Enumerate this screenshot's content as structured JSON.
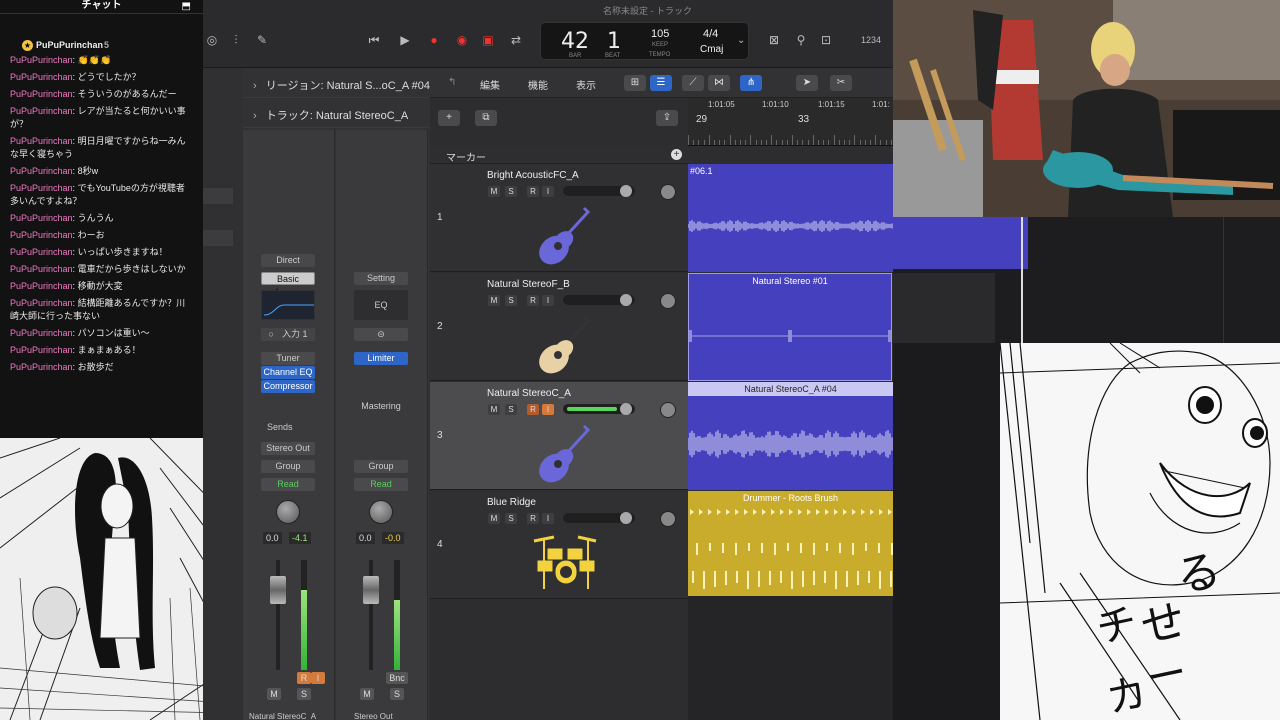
{
  "chat": {
    "title": "チャット",
    "pinned_user": "PuPuPurinchan",
    "pinned_count": "5",
    "messages": [
      {
        "user": "PuPuPurinchan",
        "text": "👏👏👏"
      },
      {
        "user": "PuPuPurinchan",
        "text": "どうでしたか？"
      },
      {
        "user": "PuPuPurinchan",
        "text": "そういうのがあるんだー"
      },
      {
        "user": "PuPuPurinchan",
        "text": "レアが当たると何かいい事が？"
      },
      {
        "user": "PuPuPurinchan",
        "text": "明日月曜ですからね一みんな早く寝ちゃう"
      },
      {
        "user": "PuPuPurinchan",
        "text": "8秒w"
      },
      {
        "user": "PuPuPurinchan",
        "text": "でもYouTubeの方が視聴者多いんですよね？"
      },
      {
        "user": "PuPuPurinchan",
        "text": "うんうん"
      },
      {
        "user": "PuPuPurinchan",
        "text": "わーお"
      },
      {
        "user": "PuPuPurinchan",
        "text": "いっぱい歩きますね！"
      },
      {
        "user": "PuPuPurinchan",
        "text": "電車だから歩きはしないか"
      },
      {
        "user": "PuPuPurinchan",
        "text": "移動が大変"
      },
      {
        "user": "PuPuPurinchan",
        "text": "結構距離あるんですか？川崎大師に行った事ない"
      },
      {
        "user": "PuPuPurinchan",
        "text": "パソコンは重い〜"
      },
      {
        "user": "PuPuPurinchan",
        "text": "まぁまぁある！"
      },
      {
        "user": "PuPuPurinchan",
        "text": "お散歩だ"
      }
    ]
  },
  "daw": {
    "window_title": "名称未設定 - トラック",
    "lcd": {
      "bar": "42",
      "beat": "1",
      "bar_label": "BAR",
      "beat_label": "BEAT",
      "tempo": "105",
      "keep": "KEEP",
      "tempo_label": "TEMPO",
      "time_sig": "4/4",
      "key": "Cmaj"
    },
    "counter": "1234",
    "inspector": {
      "region_label": "リージョン: Natural S...oC_A #04",
      "track_label": "トラック: Natural StereoC_A"
    },
    "strip1": {
      "direct": "Direct",
      "preset": "Basic Acou...",
      "input": "入力 1",
      "tuner": "Tuner",
      "eq": "Channel EQ",
      "comp": "Compressor",
      "sends": "Sends",
      "output": "Stereo Out",
      "group": "Group",
      "read": "Read",
      "pan_value": "0.0",
      "level": "-4.1",
      "r": "R",
      "i": "I",
      "m": "M",
      "s": "S",
      "name": "Natural StereoC_A"
    },
    "strip2": {
      "setting": "Setting",
      "eq": "EQ",
      "limiter": "Limiter",
      "mastering": "Mastering",
      "group": "Group",
      "read": "Read",
      "pan_value": "0.0",
      "level": "-0.0",
      "bnc": "Bnc",
      "m": "M",
      "s": "S",
      "name": "Stereo Out"
    },
    "menus": {
      "edit": "編集",
      "function": "機能",
      "view": "表示"
    },
    "marker": "マーカー",
    "ruler": {
      "times": [
        "1:01:05",
        "1:01:10",
        "1:01:15",
        "1:01:"
      ],
      "bars": [
        "29",
        "33"
      ]
    },
    "tracks": [
      {
        "num": "1",
        "name": "Bright AcousticFC_A",
        "icon": "acoustic-guitar-icon",
        "region": "#06.1"
      },
      {
        "num": "2",
        "name": "Natural StereoF_B",
        "icon": "classical-guitar-icon",
        "region": "Natural Stereo #01"
      },
      {
        "num": "3",
        "name": "Natural StereoC_A",
        "icon": "acoustic-guitar-icon",
        "region": "Natural StereoC_A #04"
      },
      {
        "num": "4",
        "name": "Blue Ridge",
        "icon": "drum-kit-icon",
        "region": "Drummer - Roots Brush"
      }
    ],
    "track_buttons": {
      "m": "M",
      "s": "S",
      "r": "R",
      "i": "I"
    }
  },
  "colors": {
    "audio_region": "#4540bd",
    "drummer_region": "#c9ac2c",
    "chat_user": "#f07bc2"
  }
}
